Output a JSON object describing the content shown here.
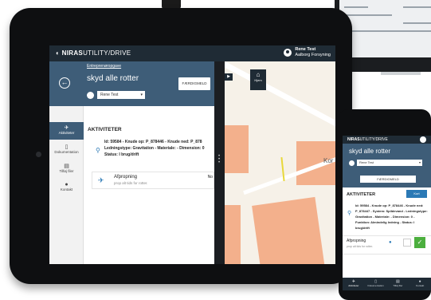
{
  "tablet": {
    "brand_bold": "NIRAS",
    "brand_light": "UTILITY/DRIVE",
    "user_name": "Rene Test",
    "user_org": "Aalborg Forsyning",
    "project_link": "Entreprenøropgave",
    "title": "skyd alle rotter",
    "finish_label": "FÆRDIGMELD",
    "assignee": "Rene Test",
    "nav": [
      {
        "label": "Aktiviteter",
        "icon": "activity-icon"
      },
      {
        "label": "Dokumentation",
        "icon": "document-icon"
      },
      {
        "label": "Tilføj filer",
        "icon": "add-file-icon"
      },
      {
        "label": "Kontakt",
        "icon": "chat-icon"
      }
    ],
    "section_title": "AKTIVITETER",
    "detail_lines": [
      "Id: 59584 - Knude op: P_878446 - Knude ned: P_878",
      "Ledningstype: Gravitation - Materiale: - Dimension: 0",
      "Status: I brug/drift"
    ],
    "activity": {
      "title": "Afpropning",
      "subtitle": "prop alt tids for rotter.",
      "right_text": "No"
    },
    "map": {
      "home_label": "Hjem",
      "place_label": "Kor"
    }
  },
  "phone": {
    "brand_bold": "NIRAS",
    "brand_light": "UTILITY/DRIVE",
    "title": "skyd alle rotter",
    "assignee": "Rene Test",
    "finish_label": "FÆRDIGMELD",
    "section_title": "AKTIVITETER",
    "add_label": "Kort",
    "detail": "Id: 59584 - Knude op: P_878446 - Knude ned: P_878447 - System: Spildevand - Ledningstype: Gravitation - Materiale: - Dimension: 0 - Funktion: Almindelig ledning - Status: I brug/drift",
    "activity_title": "Afpropning",
    "activity_subtitle": "prop alt tids for rotter.",
    "nav": [
      {
        "label": "Aktiviteter"
      },
      {
        "label": "Dokumentation"
      },
      {
        "label": "Tilføj filer"
      },
      {
        "label": "Kontakt"
      }
    ]
  },
  "colors": {
    "header_blue": "#3e5d78",
    "topbar_dark": "#1f2b35",
    "accent_blue": "#2b79b5",
    "success_green": "#4caf3e",
    "map_orange": "#f3b08c"
  }
}
